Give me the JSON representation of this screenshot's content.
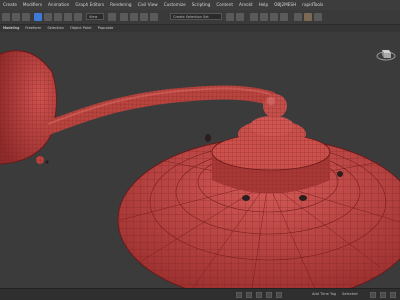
{
  "menu": {
    "items": [
      "Create",
      "Modifiers",
      "Animation",
      "Graph Editors",
      "Rendering",
      "Civil View",
      "Customize",
      "Scripting",
      "Content",
      "Arnold",
      "Help",
      "OBJ2MESH",
      "rapidTools"
    ]
  },
  "toolbar": {
    "view_dropdown": "View",
    "selection_set": "Create Selection Set"
  },
  "ribbon": {
    "tabs": [
      "Modeling",
      "Freeform",
      "Selection",
      "Object Paint",
      "Populate"
    ],
    "active_tab": 0
  },
  "statusbar": {
    "add_time_tag": "Add Time Tag",
    "selected": "Selected"
  },
  "colors": {
    "mesh_red": "#c24a48",
    "wire": "#7a1f1f",
    "viewport_bg": "#3b3b3b",
    "ui_dark": "#3a3a3a"
  },
  "icons": [
    "select-icon",
    "move-icon",
    "rotate-icon",
    "scale-icon",
    "undo-icon",
    "redo-icon",
    "link-icon",
    "render-icon",
    "viewcube-icon",
    "play-icon",
    "key-icon"
  ]
}
